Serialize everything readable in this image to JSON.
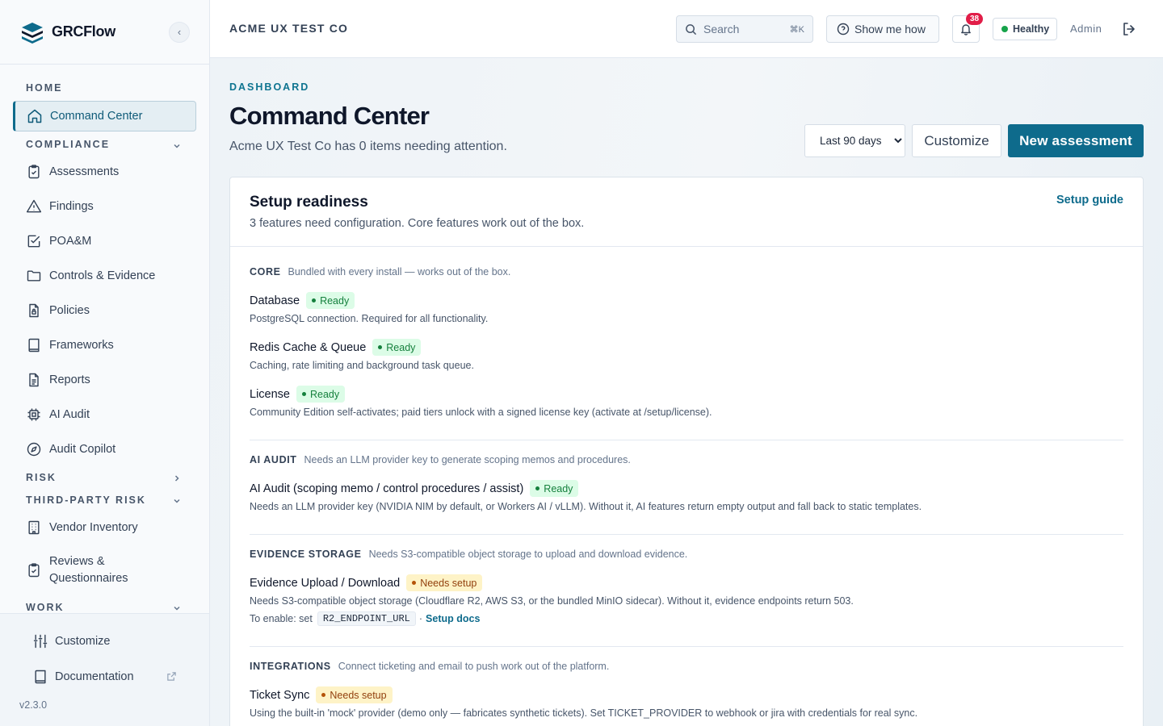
{
  "brand": {
    "name": "GRCFlow",
    "collapse_glyph": "‹"
  },
  "sidebar": {
    "sections": {
      "home": "HOME",
      "compliance": "COMPLIANCE",
      "risk": "RISK",
      "third_party": "THIRD-PARTY RISK",
      "work": "WORK"
    },
    "items": {
      "command_center": "Command Center",
      "assessments": "Assessments",
      "findings": "Findings",
      "poam": "POA&M",
      "controls": "Controls & Evidence",
      "policies": "Policies",
      "frameworks": "Frameworks",
      "reports": "Reports",
      "ai_audit": "AI Audit",
      "audit_copilot": "Audit Copilot",
      "vendor_inventory": "Vendor Inventory",
      "reviews_line1": "Reviews &",
      "reviews_line2": "Questionnaires"
    },
    "footer": {
      "customize": "Customize",
      "documentation": "Documentation",
      "version": "v2.3.0"
    }
  },
  "topbar": {
    "org": "ACME UX TEST CO",
    "search_placeholder": "Search",
    "search_shortcut": "⌘K",
    "show_me_how": "Show me how",
    "notification_count": "38",
    "health": "Healthy",
    "role": "Admin"
  },
  "page": {
    "breadcrumb": "DASHBOARD",
    "title": "Command Center",
    "subtitle": "Acme UX Test Co has 0 items needing attention.",
    "range_selected": "Last 90 days",
    "customize_label": "Customize",
    "new_assessment_label": "New assessment"
  },
  "setup": {
    "title": "Setup readiness",
    "description": "3 features need configuration. Core features work out of the box.",
    "guide_link": "Setup guide",
    "groups": [
      {
        "name": "CORE",
        "desc": "Bundled with every install — works out of the box.",
        "features": [
          {
            "name": "Database",
            "status": "Ready",
            "desc": "PostgreSQL connection. Required for all functionality."
          },
          {
            "name": "Redis Cache & Queue",
            "status": "Ready",
            "desc": "Caching, rate limiting and background task queue."
          },
          {
            "name": "License",
            "status": "Ready",
            "desc": "Community Edition self-activates; paid tiers unlock with a signed license key (activate at /setup/license)."
          }
        ]
      },
      {
        "name": "AI AUDIT",
        "desc": "Needs an LLM provider key to generate scoping memos and procedures.",
        "features": [
          {
            "name": "AI Audit (scoping memo / control procedures / assist)",
            "status": "Ready",
            "desc": "Needs an LLM provider key (NVIDIA NIM by default, or Workers AI / vLLM). Without it, AI features return empty output and fall back to static templates."
          }
        ]
      },
      {
        "name": "EVIDENCE STORAGE",
        "desc": "Needs S3-compatible object storage to upload and download evidence.",
        "features": [
          {
            "name": "Evidence Upload / Download",
            "status": "Needs setup",
            "desc": "Needs S3-compatible object storage (Cloudflare R2, AWS S3, or the bundled MinIO sidecar). Without it, evidence endpoints return 503.",
            "enable_prefix": "To enable: set",
            "enable_var": "R2_ENDPOINT_URL",
            "enable_sep": "·",
            "enable_link": "Setup docs"
          }
        ]
      },
      {
        "name": "INTEGRATIONS",
        "desc": "Connect ticketing and email to push work out of the platform.",
        "features": [
          {
            "name": "Ticket Sync",
            "status": "Needs setup",
            "desc": "Using the built-in 'mock' provider (demo only — fabricates synthetic tickets). Set TICKET_PROVIDER to webhook or jira with credentials for real sync."
          }
        ]
      }
    ]
  },
  "colors": {
    "accent": "#0e6b8c",
    "ready": "#15803d",
    "warn": "#92400e",
    "alert": "#e11d48"
  }
}
